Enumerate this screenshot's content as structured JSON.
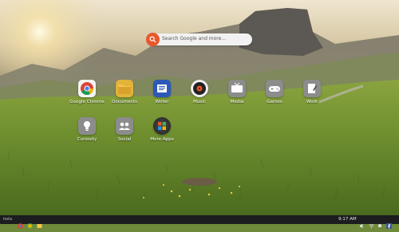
{
  "search": {
    "placeholder": "Search Google and more..."
  },
  "apps": [
    {
      "label": "Google Chrome",
      "icon": "chrome-icon"
    },
    {
      "label": "Documents",
      "icon": "folder-icon"
    },
    {
      "label": "Writer",
      "icon": "writer-icon"
    },
    {
      "label": "Music",
      "icon": "music-icon"
    },
    {
      "label": "Media",
      "icon": "tv-icon"
    },
    {
      "label": "Games",
      "icon": "gamepad-icon"
    },
    {
      "label": "Work",
      "icon": "work-icon"
    },
    {
      "label": "Curiosity",
      "icon": "lightbulb-icon"
    },
    {
      "label": "Social",
      "icon": "people-icon"
    },
    {
      "label": "More Apps",
      "icon": "more-apps-icon"
    }
  ],
  "taskbar": {
    "clock": "9:17 AM",
    "brand": "Hello"
  },
  "colors": {
    "search_button": "#e8572b",
    "taskbar": "#1b1d1f"
  }
}
